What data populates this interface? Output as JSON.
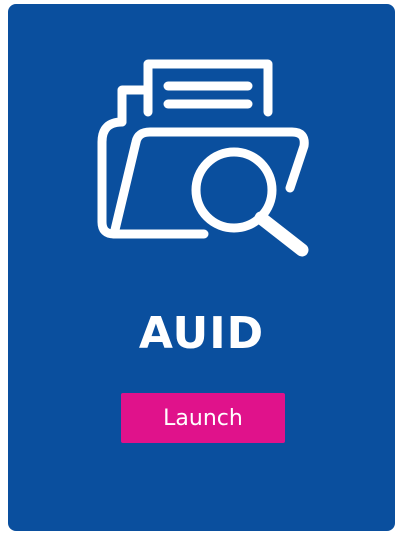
{
  "card": {
    "title": "AUID",
    "icon": "folder-search-icon",
    "launch_label": "Launch"
  },
  "colors": {
    "card_background": "#0a4f9e",
    "button_background": "#e0128b",
    "text": "#ffffff"
  }
}
